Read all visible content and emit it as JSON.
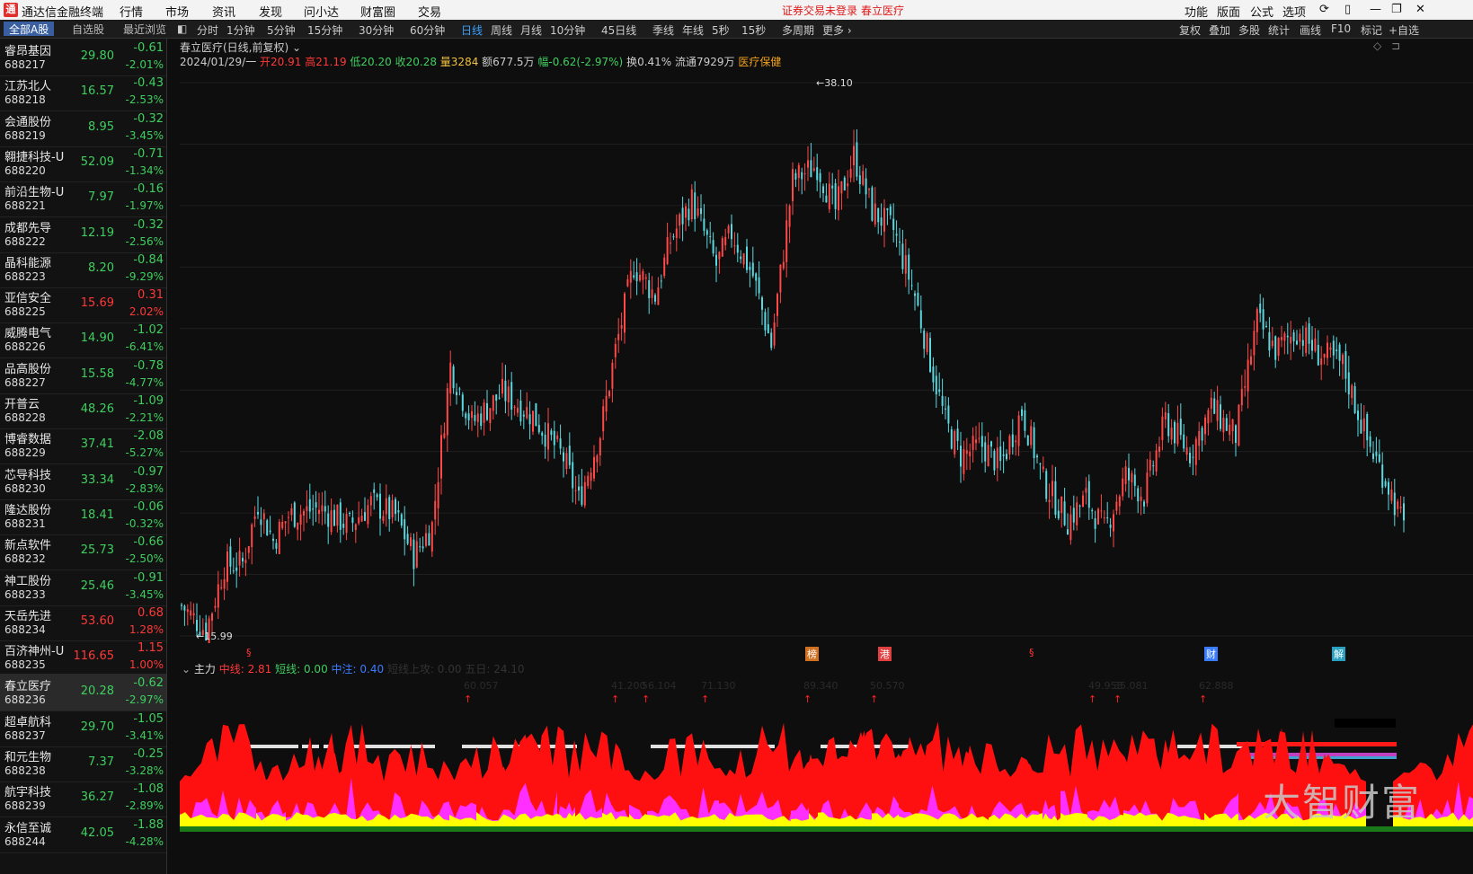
{
  "app": {
    "title": "通达信金融终端",
    "logo": "通",
    "menus": [
      "行情",
      "市场",
      "资讯",
      "发现",
      "问小达",
      "财富圈",
      "交易"
    ],
    "warning": "证券交易未登录",
    "current_stock": "春立医疗",
    "right_menus": [
      "功能",
      "版面",
      "公式",
      "选项"
    ]
  },
  "tabs": [
    "全部A股",
    "自选股",
    "最近浏览"
  ],
  "periods": [
    "分时",
    "1分钟",
    "5分钟",
    "15分钟",
    "30分钟",
    "60分钟",
    "日线",
    "周线",
    "月线",
    "10分钟",
    "45日线",
    "季线",
    "年线",
    "5秒",
    "15秒",
    "多周期",
    "更多 ›"
  ],
  "active_period": "日线",
  "right_buttons": [
    "复权",
    "叠加",
    "多股",
    "统计",
    "画线",
    "F10",
    "标记",
    "+自选"
  ],
  "stocks": [
    {
      "name": "睿昂基因",
      "code": "688217",
      "price": "29.80",
      "chg": "-0.61",
      "pct": "-2.01%",
      "dir": "dn"
    },
    {
      "name": "江苏北人",
      "code": "688218",
      "price": "16.57",
      "chg": "-0.43",
      "pct": "-2.53%",
      "dir": "dn"
    },
    {
      "name": "会通股份",
      "code": "688219",
      "price": "8.95",
      "chg": "-0.32",
      "pct": "-3.45%",
      "dir": "dn"
    },
    {
      "name": "翱捷科技-U",
      "code": "688220",
      "price": "52.09",
      "chg": "-0.71",
      "pct": "-1.34%",
      "dir": "dn"
    },
    {
      "name": "前沿生物-U",
      "code": "688221",
      "price": "7.97",
      "chg": "-0.16",
      "pct": "-1.97%",
      "dir": "dn"
    },
    {
      "name": "成都先导",
      "code": "688222",
      "price": "12.19",
      "chg": "-0.32",
      "pct": "-2.56%",
      "dir": "dn"
    },
    {
      "name": "晶科能源",
      "code": "688223",
      "price": "8.20",
      "chg": "-0.84",
      "pct": "-9.29%",
      "dir": "dn"
    },
    {
      "name": "亚信安全",
      "code": "688225",
      "price": "15.69",
      "chg": "0.31",
      "pct": "2.02%",
      "dir": "up"
    },
    {
      "name": "威腾电气",
      "code": "688226",
      "price": "14.90",
      "chg": "-1.02",
      "pct": "-6.41%",
      "dir": "dn"
    },
    {
      "name": "品高股份",
      "code": "688227",
      "price": "15.58",
      "chg": "-0.78",
      "pct": "-4.77%",
      "dir": "dn"
    },
    {
      "name": "开普云",
      "code": "688228",
      "price": "48.26",
      "chg": "-1.09",
      "pct": "-2.21%",
      "dir": "dn"
    },
    {
      "name": "博睿数据",
      "code": "688229",
      "price": "37.41",
      "chg": "-2.08",
      "pct": "-5.27%",
      "dir": "dn"
    },
    {
      "name": "芯导科技",
      "code": "688230",
      "price": "33.34",
      "chg": "-0.97",
      "pct": "-2.83%",
      "dir": "dn"
    },
    {
      "name": "隆达股份",
      "code": "688231",
      "price": "18.41",
      "chg": "-0.06",
      "pct": "-0.32%",
      "dir": "dn"
    },
    {
      "name": "新点软件",
      "code": "688232",
      "price": "25.73",
      "chg": "-0.66",
      "pct": "-2.50%",
      "dir": "dn"
    },
    {
      "name": "神工股份",
      "code": "688233",
      "price": "25.46",
      "chg": "-0.91",
      "pct": "-3.45%",
      "dir": "dn"
    },
    {
      "name": "天岳先进",
      "code": "688234",
      "price": "53.60",
      "chg": "0.68",
      "pct": "1.28%",
      "dir": "up"
    },
    {
      "name": "百济神州-U",
      "code": "688235",
      "price": "116.65",
      "chg": "1.15",
      "pct": "1.00%",
      "dir": "up"
    },
    {
      "name": "春立医疗",
      "code": "688236",
      "price": "20.28",
      "chg": "-0.62",
      "pct": "-2.97%",
      "dir": "dn",
      "sel": true
    },
    {
      "name": "超卓航科",
      "code": "688237",
      "price": "29.70",
      "chg": "-1.05",
      "pct": "-3.41%",
      "dir": "dn"
    },
    {
      "name": "和元生物",
      "code": "688238",
      "price": "7.37",
      "chg": "-0.25",
      "pct": "-3.28%",
      "dir": "dn"
    },
    {
      "name": "航宇科技",
      "code": "688239",
      "price": "36.27",
      "chg": "-1.08",
      "pct": "-2.89%",
      "dir": "dn"
    },
    {
      "name": "永信至诚",
      "code": "688244",
      "price": "42.05",
      "chg": "-1.88",
      "pct": "-4.28%",
      "dir": "dn"
    }
  ],
  "chart": {
    "title": "春立医疗(日线,前复权)",
    "date": "2024/01/29/一",
    "open_label": "开20.91",
    "high_label": "高21.19",
    "low_label": "低20.20",
    "close_label": "收20.28",
    "vol_label": "量3284",
    "amt_label": "额677.5万",
    "range_label": "幅-0.62(-2.97%)",
    "turnover_label": "换0.41%",
    "float_label": "流通7929万",
    "sector": "医疗保健",
    "hi_label": "38.10",
    "lo_label": "15.99",
    "markers": [
      "§",
      "榜",
      "港",
      "§",
      "财",
      "解"
    ]
  },
  "sub": {
    "name": "主力",
    "mid": "中线: 2.81",
    "short": "短线: 0.00",
    "mid2": "中注: 0.40",
    "attack": "短线上攻: 0.00",
    "five": "五日: 24.10",
    "signals": [
      "60.057",
      "41.200",
      "56.104",
      "71.130",
      "89.340",
      "50.570",
      "49.953",
      "35.081",
      "62.888"
    ]
  },
  "watermark": "大智财富",
  "colors": {
    "up": "#ff3838",
    "down": "#3fcf5f",
    "candle_up": "#ff4848",
    "candle_dn": "#5ad8e0"
  },
  "chart_data": {
    "type": "candlestick",
    "ylim": [
      15.99,
      38.1
    ],
    "high": 38.1,
    "low": 15.99,
    "last_close": 20.28
  }
}
